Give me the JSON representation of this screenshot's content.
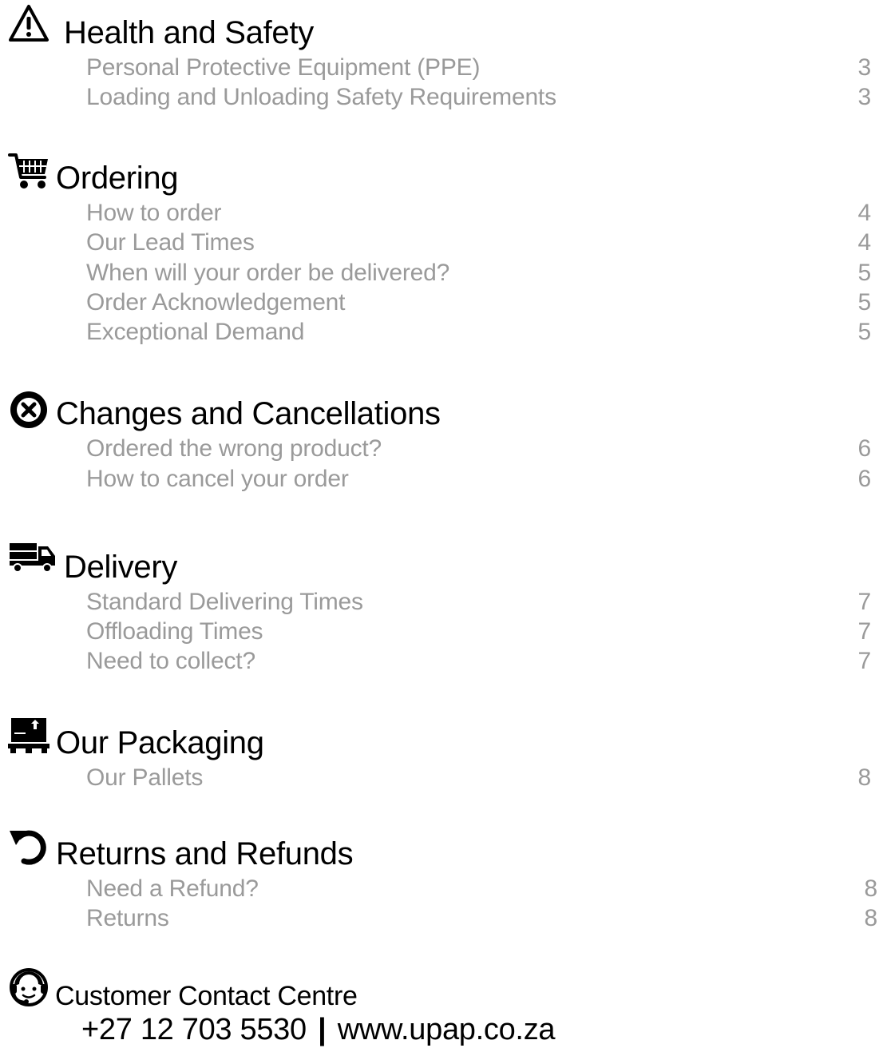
{
  "sections": [
    {
      "icon": "warning-icon",
      "title": "Health and Safety",
      "items": [
        {
          "label": "Personal Protective Equipment (PPE)",
          "page": "3"
        },
        {
          "label": "Loading and Unloading Safety Requirements",
          "page": "3"
        }
      ]
    },
    {
      "icon": "shopping-cart-icon",
      "title": "Ordering",
      "items": [
        {
          "label": "How to order",
          "page": "4"
        },
        {
          "label": "Our Lead Times",
          "page": "4"
        },
        {
          "label": "When will your order be delivered?",
          "page": "5"
        },
        {
          "label": "Order Acknowledgement",
          "page": "5"
        },
        {
          "label": "Exceptional Demand",
          "page": "5"
        }
      ]
    },
    {
      "icon": "cancel-circle-icon",
      "title": "Changes and Cancellations",
      "items": [
        {
          "label": "Ordered the wrong product?",
          "page": "6"
        },
        {
          "label": "How to cancel your order",
          "page": "6"
        }
      ]
    },
    {
      "icon": "truck-icon",
      "title": "Delivery",
      "items": [
        {
          "label": "Standard Delivering Times",
          "page": "7"
        },
        {
          "label": "Offloading Times",
          "page": "7"
        },
        {
          "label": "Need to collect?",
          "page": "7"
        }
      ]
    },
    {
      "icon": "pallet-box-icon",
      "title": "Our Packaging",
      "items": [
        {
          "label": "Our Pallets",
          "page": "8"
        }
      ]
    },
    {
      "icon": "undo-arrow-icon",
      "title": "Returns and Refunds",
      "items": [
        {
          "label": "Need a Refund?",
          "page": "8"
        },
        {
          "label": "Returns",
          "page": "8"
        }
      ]
    }
  ],
  "contact": {
    "icon": "headset-agent-icon",
    "title": "Customer Contact Centre",
    "phone": "+27 12 703 5530",
    "separator": "|",
    "website": "www.upap.co.za"
  },
  "colors": {
    "heading": "#000000",
    "entry": "#9a9a9a"
  }
}
